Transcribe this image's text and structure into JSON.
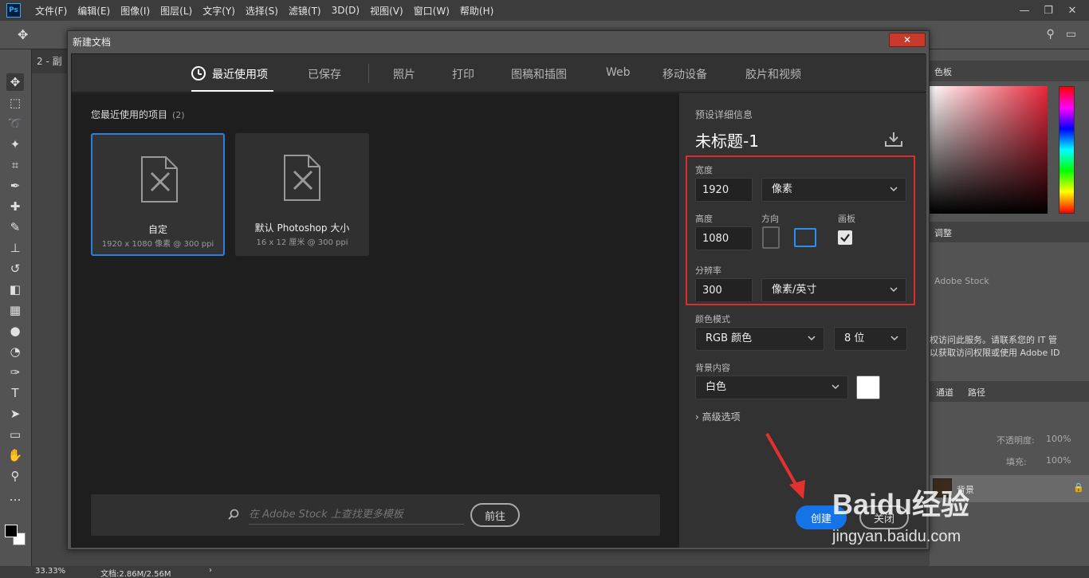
{
  "app": {
    "logo": "Ps"
  },
  "menu": [
    "文件(F)",
    "编辑(E)",
    "图像(I)",
    "图层(L)",
    "文字(Y)",
    "选择(S)",
    "滤镜(T)",
    "3D(D)",
    "视图(V)",
    "窗口(W)",
    "帮助(H)"
  ],
  "doc_tab": {
    "label": "2 - 副"
  },
  "status": {
    "zoom": "33.33%",
    "doc": "文档:2.86M/2.56M",
    "arrow": "›"
  },
  "right_panels": {
    "color_tab": "色板",
    "adjust_tab": "调整",
    "stock_label": "Adobe Stock",
    "service_msg_1": "权访问此服务。请联系您的 IT 管",
    "service_msg_2": "以获取访问权限或使用 Adobe ID",
    "channels_tab": "通道",
    "paths_tab": "路径",
    "opacity_label": "不透明度:",
    "opacity_value": "100%",
    "fill_label": "填充:",
    "fill_value": "100%",
    "layer_name": "背景"
  },
  "dialog": {
    "title": "新建文档",
    "close_label": "✕",
    "tabs": [
      "最近使用项",
      "已保存",
      "照片",
      "打印",
      "图稿和插图",
      "Web",
      "移动设备",
      "胶片和视频"
    ],
    "recent": {
      "title": "您最近使用的项目",
      "count": "(2)",
      "presets": [
        {
          "name": "自定",
          "desc": "1920 x 1080 像素 @ 300 ppi"
        },
        {
          "name": "默认 Photoshop 大小",
          "desc": "16 x 12 厘米 @ 300 ppi"
        }
      ]
    },
    "stock": {
      "placeholder": "在 Adobe Stock 上查找更多模板",
      "go_label": "前往"
    },
    "details": {
      "header": "预设详细信息",
      "doc_name": "未标题-1",
      "width_label": "宽度",
      "width_value": "1920",
      "width_unit": "像素",
      "height_label": "高度",
      "height_value": "1080",
      "orientation_label": "方向",
      "artboard_label": "画板",
      "artboard_checked": true,
      "resolution_label": "分辨率",
      "resolution_value": "300",
      "resolution_unit": "像素/英寸",
      "color_mode_label": "颜色模式",
      "color_mode": "RGB 颜色",
      "bit_depth": "8 位",
      "bg_label": "背景内容",
      "bg_value": "白色",
      "bg_color": "#ffffff",
      "advanced_label": "高级选项",
      "create_label": "创建",
      "close_button_label": "关闭"
    }
  },
  "watermark": {
    "brand": "Baidu经验",
    "url": "jingyan.baidu.com"
  },
  "colors": {
    "accent": "#1473e6",
    "highlight_box": "#e02b2b",
    "selected_card": "#2b7fe0"
  }
}
